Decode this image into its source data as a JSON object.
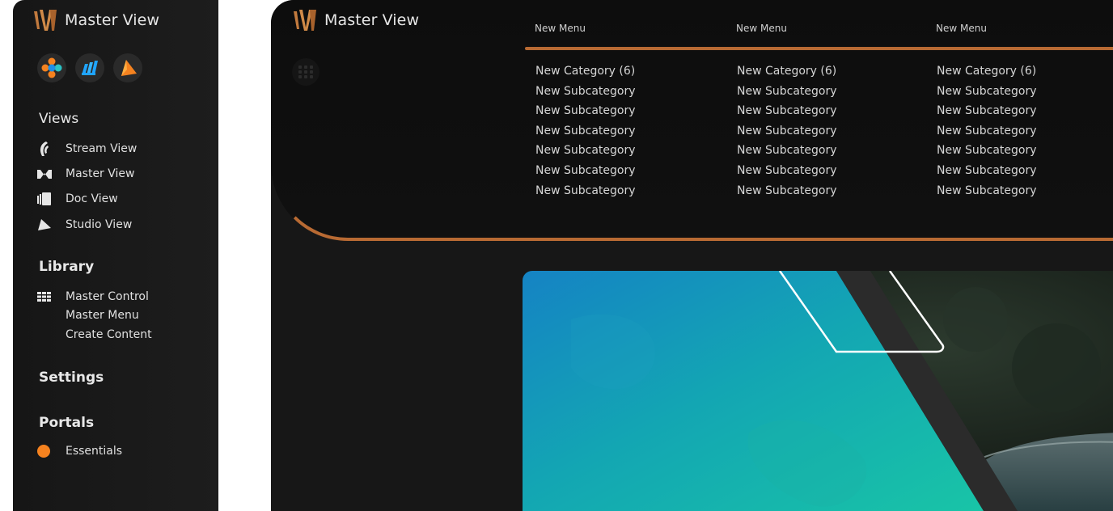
{
  "brand": {
    "name": "Master View"
  },
  "sidebar": {
    "apps": [
      {
        "icon": "globe-app-icon"
      },
      {
        "icon": "blue-bars-app-icon"
      },
      {
        "icon": "orange-play-app-icon"
      }
    ],
    "views_title": "Views",
    "views": [
      {
        "label": "Stream View",
        "icon": "stream-view-icon"
      },
      {
        "label": "Master View",
        "icon": "master-view-icon"
      },
      {
        "label": "Doc View",
        "icon": "doc-view-icon"
      },
      {
        "label": "Studio View",
        "icon": "studio-view-icon"
      }
    ],
    "library_title": "Library",
    "library": [
      {
        "label": "Master Control",
        "icon": "grid-icon"
      },
      {
        "label": "Master Menu"
      },
      {
        "label": "Create Content"
      }
    ],
    "settings_title": "Settings",
    "portals_title": "Portals",
    "portals": [
      {
        "label": "Essentials",
        "color": "#f5821f"
      }
    ]
  },
  "main": {
    "menus": [
      "New Menu",
      "New Menu",
      "New Menu"
    ],
    "columns": [
      {
        "category": "New Category (6)",
        "subcategories": [
          "New Subcategory",
          "New Subcategory",
          "New Subcategory",
          "New Subcategory",
          "New Subcategory",
          "New Subcategory"
        ]
      },
      {
        "category": "New Category (6)",
        "subcategories": [
          "New Subcategory",
          "New Subcategory",
          "New Subcategory",
          "New Subcategory",
          "New Subcategory",
          "New Subcategory"
        ]
      },
      {
        "category": "New Category (6)",
        "subcategories": [
          "New Subcategory",
          "New Subcategory",
          "New Subcategory",
          "New Subcategory",
          "New Subcategory",
          "New Subcategory"
        ]
      }
    ]
  },
  "colors": {
    "accent": "#b86a33",
    "portal": "#f5821f",
    "app_blue": "#1fa4ff"
  }
}
